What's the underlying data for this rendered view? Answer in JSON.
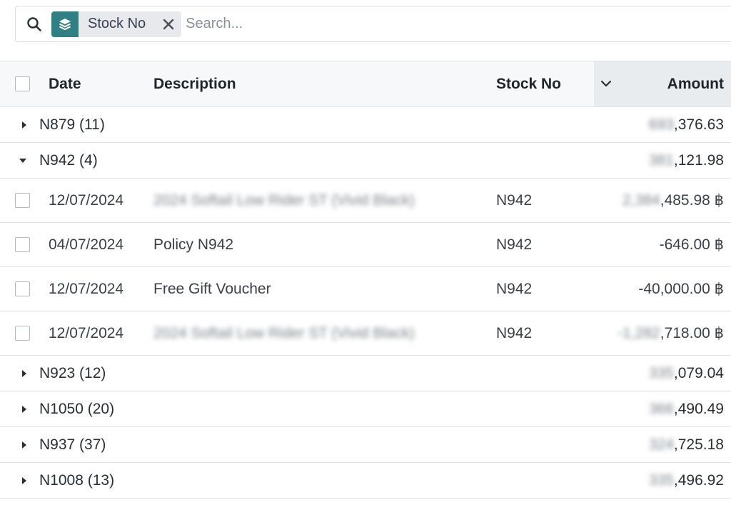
{
  "search": {
    "facet_label": "Stock No",
    "placeholder": "Search..."
  },
  "table": {
    "columns": {
      "date": "Date",
      "description": "Description",
      "stock_no": "Stock No",
      "amount": "Amount"
    },
    "groups": [
      {
        "label": "N879 (11)",
        "amount_hidden": "693",
        "amount_visible": ",376.63",
        "expanded": false
      },
      {
        "label": "N942 (4)",
        "amount_hidden": "381",
        "amount_visible": ",121.98",
        "expanded": true,
        "rows": [
          {
            "date": "12/07/2024",
            "description": "2024 Softail Low Rider ST (Vivid Black)",
            "description_blurred": true,
            "stock_no": "N942",
            "amount_hidden": "2,384",
            "amount_visible": ",485.98 ฿"
          },
          {
            "date": "04/07/2024",
            "description": "Policy N942",
            "description_blurred": false,
            "stock_no": "N942",
            "amount_hidden": "",
            "amount_visible": "-646.00 ฿"
          },
          {
            "date": "12/07/2024",
            "description": "Free Gift Voucher",
            "description_blurred": false,
            "stock_no": "N942",
            "amount_hidden": "",
            "amount_visible": "-40,000.00 ฿"
          },
          {
            "date": "12/07/2024",
            "description": "2024 Softail Low Rider ST (Vivid Black)",
            "description_blurred": true,
            "stock_no": "N942",
            "amount_hidden": "-1,282",
            "amount_visible": ",718.00 ฿"
          }
        ]
      },
      {
        "label": "N923 (12)",
        "amount_hidden": "335",
        "amount_visible": ",079.04",
        "expanded": false
      },
      {
        "label": "N1050 (20)",
        "amount_hidden": "366",
        "amount_visible": ",490.49",
        "expanded": false
      },
      {
        "label": "N937 (37)",
        "amount_hidden": "324",
        "amount_visible": ",725.18",
        "expanded": false
      },
      {
        "label": "N1008 (13)",
        "amount_hidden": "335",
        "amount_visible": ",496.92",
        "expanded": false
      }
    ]
  },
  "colors": {
    "facet_accent": "#2f7f83",
    "header_bg": "#f7f8fa",
    "sort_header_bg": "#e9ecef",
    "border": "#dee2e6"
  },
  "icons": {
    "search": "search-icon",
    "facet": "layers-icon",
    "facet_close": "close-icon",
    "sort": "chevron-down-icon",
    "collapsed": "caret-right-icon",
    "expanded": "caret-down-icon"
  }
}
